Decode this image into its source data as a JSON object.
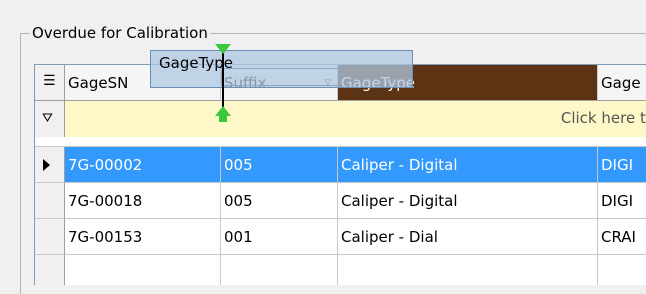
{
  "groupbox": {
    "title": "Overdue for Calibration"
  },
  "grid": {
    "columns": [
      {
        "key": "gagesn",
        "label": "GageSN"
      },
      {
        "key": "suffix",
        "label": "Suffix"
      },
      {
        "key": "gagetype",
        "label": "GageType"
      },
      {
        "key": "gage",
        "label": "Gage"
      }
    ],
    "filter_hint": "Click here to",
    "rows": [
      {
        "gagesn": "7G-00002",
        "suffix": "005",
        "gagetype": "Caliper - Digital",
        "gage": "DIGI",
        "selected": true
      },
      {
        "gagesn": "7G-00018",
        "suffix": "005",
        "gagetype": "Caliper - Digital",
        "gage": "DIGI",
        "selected": false
      },
      {
        "gagesn": "7G-00153",
        "suffix": "001",
        "gagetype": "Caliper - Dial",
        "gage": "CRAI",
        "selected": false
      }
    ]
  },
  "drag": {
    "label": "GageType"
  },
  "colors": {
    "active_header": "#5c3413",
    "selection": "#3399ff",
    "filter_row": "#fff8c8",
    "drop_arrow": "#3cc83c"
  },
  "icons": {
    "column_chooser": "column-chooser-icon",
    "filter": "filter-icon",
    "row_pointer": "row-pointer-icon"
  }
}
